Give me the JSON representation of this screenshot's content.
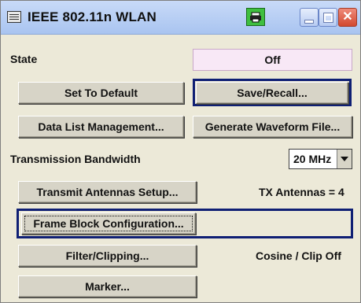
{
  "window": {
    "title": "IEEE 802.11n WLAN"
  },
  "state": {
    "label": "State",
    "value": "Off"
  },
  "buttons": {
    "set_default": "Set To Default",
    "save_recall": "Save/Recall...",
    "data_list": "Data List Management...",
    "generate_waveform": "Generate Waveform File...",
    "transmit_antennas": "Transmit Antennas Setup...",
    "frame_block": "Frame Block Configuration...",
    "filter_clipping": "Filter/Clipping...",
    "marker": "Marker..."
  },
  "transmission_bandwidth": {
    "label": "Transmission Bandwidth",
    "value": "20 MHz"
  },
  "info": {
    "tx_antennas": "TX Antennas = 4",
    "filter_status": "Cosine  /  Clip Off"
  },
  "colors": {
    "focus_border": "#0f1f74",
    "state_bg": "#f8e8f6",
    "print_icon": "#3fbf3f"
  }
}
